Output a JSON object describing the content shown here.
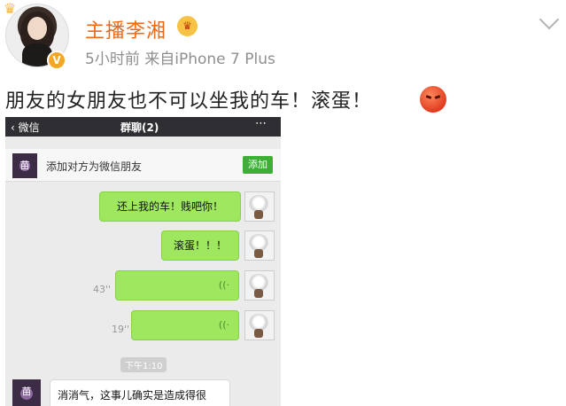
{
  "post": {
    "author": "主播李湘",
    "author_badge": "♛",
    "verified_badge": "V",
    "meta": "5小时前  来自iPhone 7 Plus",
    "text": "朋友的女朋友也不可以坐我的车！滚蛋！",
    "emoji": "angry-face"
  },
  "chat": {
    "back_label": "微信",
    "title": "群聊(2)",
    "menu_icon": "⋯",
    "add_friend": {
      "avatar_text": "苗",
      "text": "添加对方为微信朋友",
      "button": "添加"
    },
    "messages": [
      {
        "text": "还上我的车！贱吧你！"
      },
      {
        "text": "滚蛋！！！"
      },
      {
        "voice_duration": "43''",
        "voice_icon": "((·"
      },
      {
        "voice_duration": "19''",
        "voice_icon": "((·"
      }
    ],
    "timestamp": "下午1:10",
    "incoming": {
      "avatar_text": "苗",
      "text": "消消气，这事儿确实是造成得很"
    }
  },
  "colors": {
    "author_name": "#ec6a17",
    "outgoing_bubble": "#9ee75f",
    "add_button": "#3cb035"
  }
}
